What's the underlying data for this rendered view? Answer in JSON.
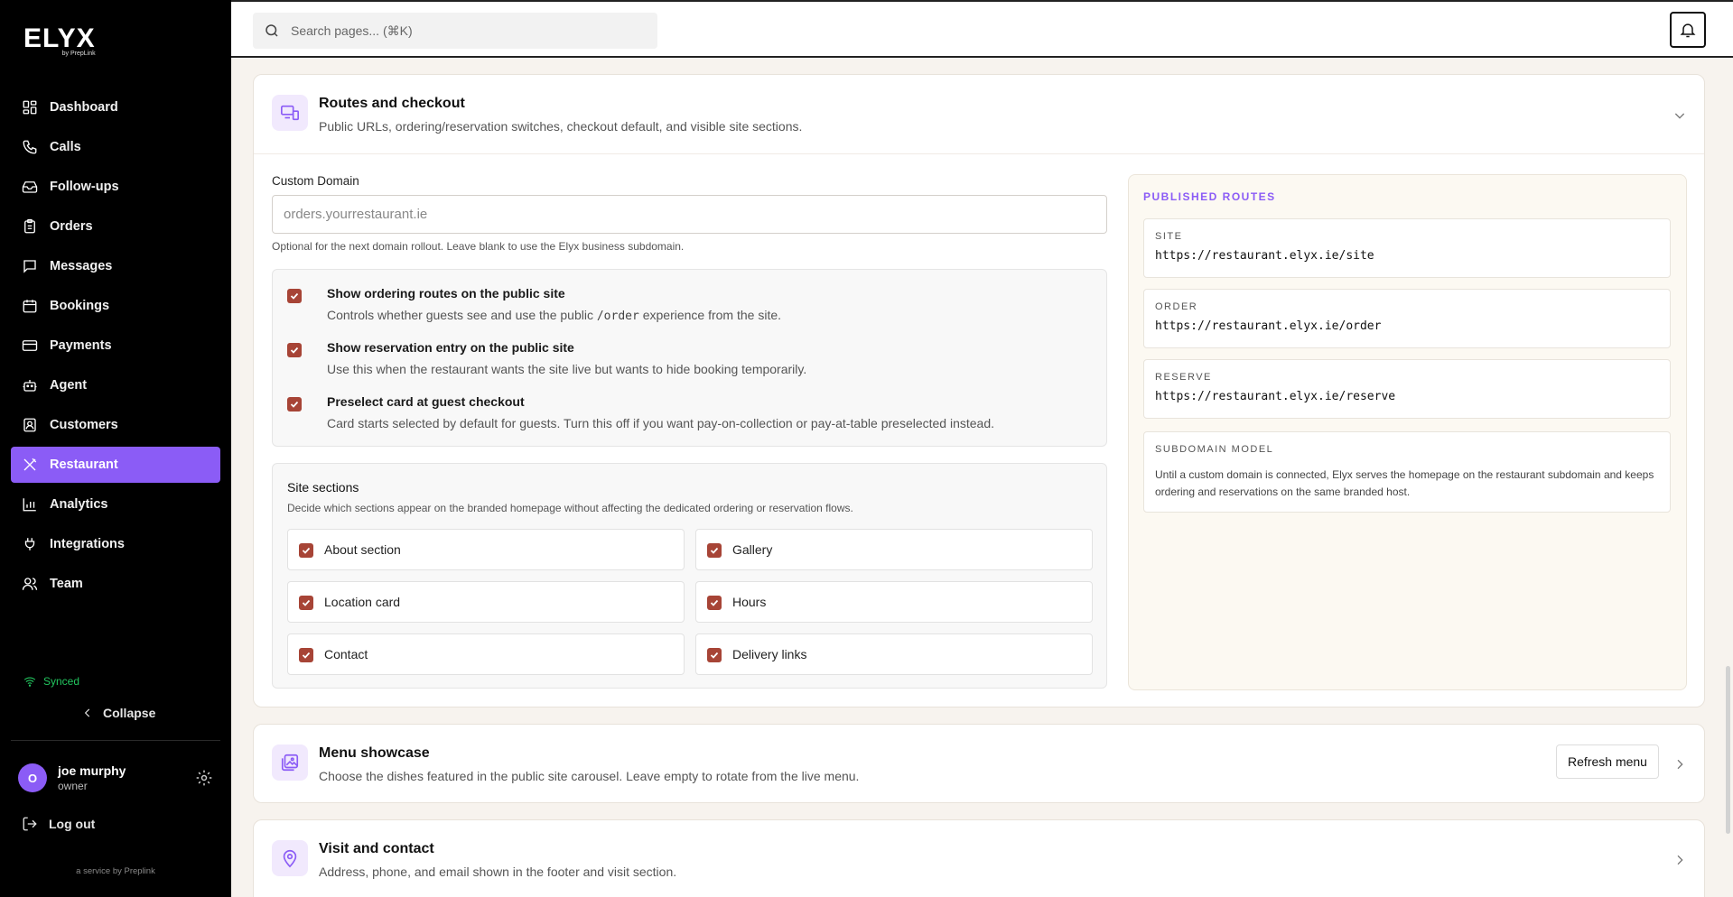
{
  "brand": {
    "name": "ELYX",
    "sub": "by PrepLink"
  },
  "search": {
    "placeholder": "Search pages... (⌘K)"
  },
  "sidebar": {
    "items": [
      {
        "label": "Dashboard",
        "icon": "dashboard-icon"
      },
      {
        "label": "Calls",
        "icon": "phone-icon"
      },
      {
        "label": "Follow-ups",
        "icon": "inbox-icon"
      },
      {
        "label": "Orders",
        "icon": "clipboard-icon"
      },
      {
        "label": "Messages",
        "icon": "message-icon"
      },
      {
        "label": "Bookings",
        "icon": "calendar-icon"
      },
      {
        "label": "Payments",
        "icon": "credit-card-icon"
      },
      {
        "label": "Agent",
        "icon": "robot-icon"
      },
      {
        "label": "Customers",
        "icon": "contact-icon"
      },
      {
        "label": "Restaurant",
        "icon": "utensils-icon",
        "active": true
      },
      {
        "label": "Analytics",
        "icon": "bar-chart-icon"
      },
      {
        "label": "Integrations",
        "icon": "plug-icon"
      },
      {
        "label": "Team",
        "icon": "users-icon"
      }
    ],
    "status": "Synced",
    "collapse": "Collapse",
    "user": {
      "initial": "O",
      "name": "joe murphy",
      "role": "owner"
    },
    "logout": "Log out",
    "service": "a service by Preplink"
  },
  "routes_card": {
    "title": "Routes and checkout",
    "description": "Public URLs, ordering/reservation switches, checkout default, and visible site sections.",
    "custom_domain": {
      "label": "Custom Domain",
      "placeholder": "orders.yourrestaurant.ie",
      "value": "",
      "helper": "Optional for the next domain rollout. Leave blank to use the Elyx business subdomain."
    },
    "toggles": [
      {
        "title": "Show ordering routes on the public site",
        "desc_before": "Controls whether guests see and use the public ",
        "desc_code": "/order",
        "desc_after": " experience from the site.",
        "checked": true
      },
      {
        "title": "Show reservation entry on the public site",
        "desc_before": "Use this when the restaurant wants the site live but wants to hide booking temporarily.",
        "desc_code": "",
        "desc_after": "",
        "checked": true
      },
      {
        "title": "Preselect card at guest checkout",
        "desc_before": "Card starts selected by default for guests. Turn this off if you want pay-on-collection or pay-at-table preselected instead.",
        "desc_code": "",
        "desc_after": "",
        "checked": true
      }
    ],
    "site_sections": {
      "title": "Site sections",
      "description": "Decide which sections appear on the branded homepage without affecting the dedicated ordering or reservation flows.",
      "items": [
        {
          "label": "About section",
          "checked": true
        },
        {
          "label": "Gallery",
          "checked": true
        },
        {
          "label": "Location card",
          "checked": true
        },
        {
          "label": "Hours",
          "checked": true
        },
        {
          "label": "Contact",
          "checked": true
        },
        {
          "label": "Delivery links",
          "checked": true
        }
      ]
    },
    "published_routes": {
      "title": "PUBLISHED ROUTES",
      "routes": [
        {
          "label": "SITE",
          "url": "https://restaurant.elyx.ie/site"
        },
        {
          "label": "ORDER",
          "url": "https://restaurant.elyx.ie/order"
        },
        {
          "label": "RESERVE",
          "url": "https://restaurant.elyx.ie/reserve"
        }
      ],
      "subdomain": {
        "label": "SUBDOMAIN MODEL",
        "text": "Until a custom domain is connected, Elyx serves the homepage on the restaurant subdomain and keeps ordering and reservations on the same branded host."
      }
    }
  },
  "menu_card": {
    "title": "Menu showcase",
    "description": "Choose the dishes featured in the public site carousel. Leave empty to rotate from the live menu.",
    "button": "Refresh menu"
  },
  "visit_card": {
    "title": "Visit and contact",
    "description": "Address, phone, and email shown in the footer and visit section."
  },
  "colors": {
    "accent": "#8b5cf6",
    "checkbox": "#a74436",
    "synced": "#22c55e"
  }
}
